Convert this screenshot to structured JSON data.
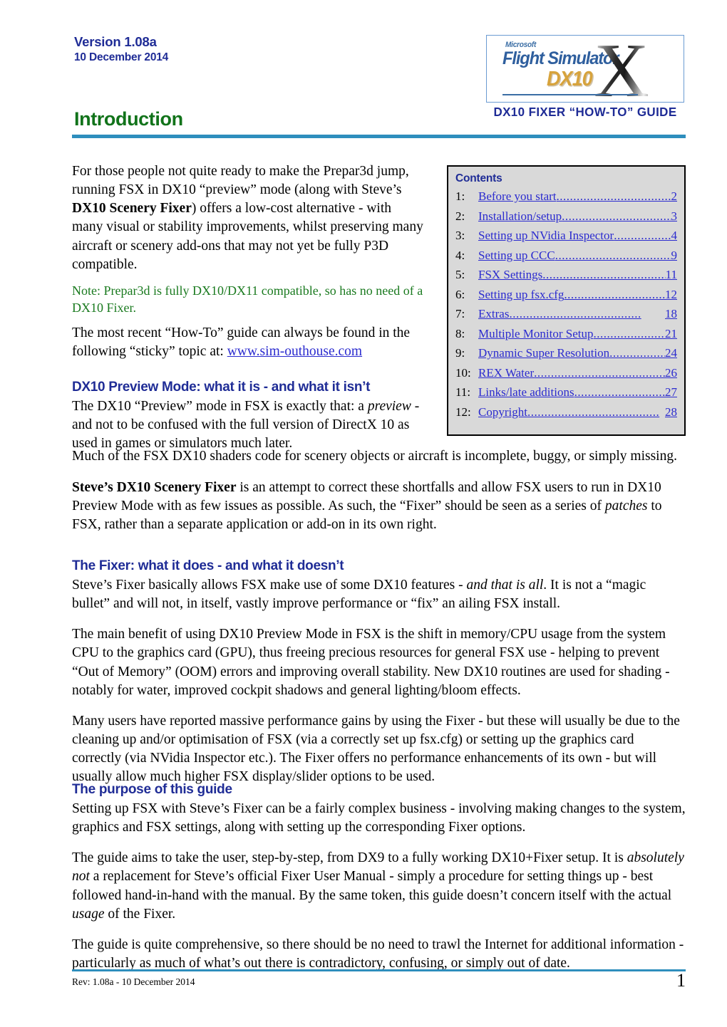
{
  "header": {
    "version": "Version 1.08a",
    "date": "10 December 2014",
    "title": "Introduction",
    "logo": {
      "microsoft": "Microsoft",
      "flight_simulator": "Flight Simulator",
      "dx10": "DX10",
      "x": "X",
      "caption": "DX10 FIXER “HOW-TO” GUIDE"
    }
  },
  "colors": {
    "rule_blue": "#2e8ebd",
    "heading_green": "#11731a",
    "heading_navy": "#1f2c96",
    "link_blue": "#2b2bcf",
    "note_green": "#1a7a1f",
    "contents_bg": "#d9d9d9"
  },
  "contents": {
    "title": "Contents",
    "items": [
      {
        "num": "1:",
        "label": "Before you start",
        "page": "2"
      },
      {
        "num": "2:",
        "label": "Installation/setup",
        "page": "3"
      },
      {
        "num": "3:",
        "label": "Setting up NVidia Inspector",
        "page": "4"
      },
      {
        "num": "4:",
        "label": "Setting up CCC",
        "page": "9"
      },
      {
        "num": "5:",
        "label": "FSX Settings",
        "page": "11"
      },
      {
        "num": "6:",
        "label": "Setting up fsx.cfg",
        "page": "12"
      },
      {
        "num": "7:",
        "label": "Extras",
        "page": "18"
      },
      {
        "num": "8:",
        "label": "Multiple Monitor Setup",
        "page": "21"
      },
      {
        "num": "9:",
        "label": "Dynamic Super Resolution",
        "page": "24"
      },
      {
        "num": "10:",
        "label": "REX Water",
        "page": "26"
      },
      {
        "num": "11:",
        "label": "Links/late additions",
        "page": "27"
      },
      {
        "num": "12:",
        "label": "Copyright",
        "page": "28"
      }
    ]
  },
  "body": {
    "intro_p1_a": "For those people not quite ready to make the Prepar3d jump, running FSX in DX10 “preview” mode (along with Steve’s ",
    "intro_p1_b": "DX10 Scenery Fixer",
    "intro_p1_c": ") offers a low-cost alternative - with many visual or stability improvements, whilst preserving many aircraft or scenery add-ons that may not yet be fully P3D compatible.",
    "note_p": "Note: Prepar3d is fully DX10/DX11 compatible, so has no need of a DX10 Fixer.",
    "howto_a": "The most recent “How-To” guide can always be found in the following “sticky” topic at: ",
    "howto_link": "www.sim-outhouse.com",
    "h_preview": "DX10 Preview Mode: what it is - and what it isn’t",
    "preview_a": "The DX10 “Preview” mode in FSX is exactly that: a ",
    "preview_i": "preview",
    "preview_b": " - and not to be confused with the full version of DirectX 10 as used in games or simulators much later.",
    "preview_c": "Much of the FSX DX10 shaders code for scenery objects or aircraft is incomplete, buggy, or simply missing.",
    "steve_b": "Steve’s DX10 Scenery Fixer",
    "steve_a": " is an attempt to correct these shortfalls and allow FSX users to run in DX10 Preview Mode with as few issues as possible. As such, the “Fixer” should be seen as a series of ",
    "steve_i": "patches",
    "steve_c": " to FSX, rather than a separate application or add-on in its own right.",
    "h_fixer": "The Fixer: what it does - and what it doesn’t",
    "fixer_a": "Steve’s Fixer basically allows FSX make use of some DX10 features - ",
    "fixer_i": "and that is all",
    "fixer_b": ". It is not a “magic bullet” and will not, in itself, vastly improve performance or “fix” an ailing FSX install.",
    "fixer_p2": "The main benefit of using DX10 Preview Mode in FSX is the shift in memory/CPU usage from the system CPU to the graphics card (GPU), thus freeing precious resources for general FSX use - helping to prevent “Out of Memory” (OOM) errors and improving overall stability. New DX10 routines are used for shading - notably for water, improved cockpit shadows and general lighting/bloom effects.",
    "fixer_p3": "Many users have reported massive performance gains by using the Fixer - but these will usually be due to the cleaning up and/or optimisation of FSX (via a correctly set up fsx.cfg) or setting up the graphics card correctly (via NVidia Inspector etc.). The Fixer offers no performance enhancements of its own - but will usually allow much higher FSX display/slider options to be used.",
    "h_purpose": "The purpose of this guide",
    "purpose_p1": "Setting up FSX with Steve’s Fixer can be a fairly complex business - involving making changes to the system, graphics and FSX settings, along with setting up the corresponding Fixer options.",
    "purpose_p2_a": "The guide aims to take the user, step-by-step, from DX9 to a fully working DX10+Fixer setup. It is ",
    "purpose_p2_i": "absolutely not",
    "purpose_p2_b": " a replacement for Steve’s official Fixer User Manual - simply a procedure for setting things up - best followed hand-in-hand with the manual. By the same token, this guide doesn’t concern itself with the actual ",
    "purpose_p2_i2": "usage",
    "purpose_p2_c": " of the Fixer.",
    "purpose_p3": "The guide is quite comprehensive, so there should be no need to trawl the Internet for additional information - particularly as much of what’s out there is contradictory, confusing, or simply out of date."
  },
  "footer": {
    "revision": "Rev: 1.08a - 10 December 2014",
    "page_number": "1"
  }
}
